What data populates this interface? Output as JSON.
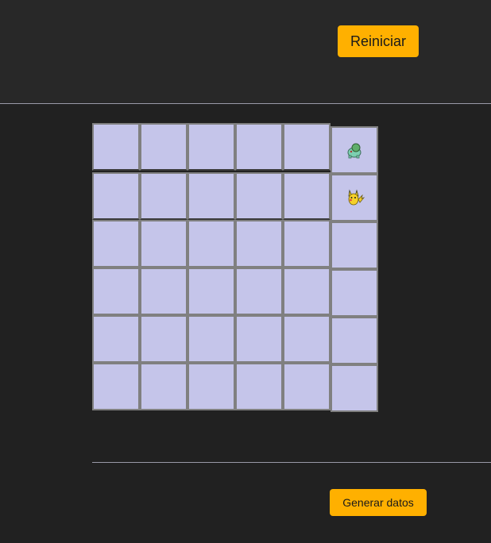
{
  "header": {
    "reset_label": "Reiniciar"
  },
  "board": {
    "rows": 6,
    "cols": 6,
    "cell_color": "#c5c5ea",
    "border_color": "#808080",
    "pieces": [
      {
        "row": 0,
        "col": 5,
        "icon": "bulbasaur-icon"
      },
      {
        "row": 1,
        "col": 5,
        "icon": "pikachu-icon"
      }
    ]
  },
  "footer": {
    "generate_label": "Generar datos"
  },
  "colors": {
    "accent": "#ffb000",
    "background": "#212121",
    "header_background": "#282828"
  }
}
